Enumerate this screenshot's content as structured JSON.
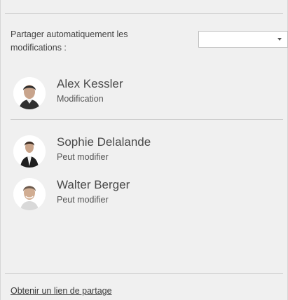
{
  "auto_share": {
    "label": "Partager automatiquement les\nmodifications :",
    "selected_value": ""
  },
  "owner": {
    "name": "Alex Kessler",
    "role": "Modification",
    "avatar_icon": "avatar-photo-icon"
  },
  "collaborators": [
    {
      "name": "Sophie Delalande",
      "role": "Peut modifier",
      "avatar_icon": "avatar-photo-icon"
    },
    {
      "name": "Walter Berger",
      "role": "Peut modifier",
      "avatar_icon": "avatar-photo-icon"
    }
  ],
  "footer": {
    "share_link_label": "Obtenir un lien de partage"
  },
  "colors": {
    "background": "#f0f0f0",
    "divider": "#cfcfcf",
    "text": "#4a4a4a"
  }
}
